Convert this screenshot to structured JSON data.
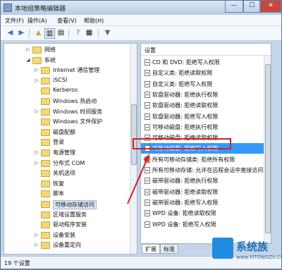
{
  "window": {
    "title": "本地组策略编辑器",
    "min": "—",
    "max": "☐",
    "close": "✕"
  },
  "menu": [
    "文件(F)",
    "操作(A)",
    "查看(V)",
    "帮助(H)"
  ],
  "toolbar": {
    "icons": [
      "back-icon",
      "forward-icon",
      "up-folder-icon",
      "show-tree-icon",
      "export-icon",
      "help-icon",
      "properties-icon",
      "filter-icon"
    ]
  },
  "tree": [
    {
      "label": "网络",
      "expander": "▷"
    },
    {
      "label": "系统",
      "expander": "◢"
    },
    {
      "label": "Internet 通信管理",
      "expander": "▷"
    },
    {
      "label": "iSCSI",
      "expander": "▷"
    },
    {
      "label": "Kerberos",
      "expander": ""
    },
    {
      "label": "Windows 热启动",
      "expander": ""
    },
    {
      "label": "Windows 时间服务",
      "expander": "▷"
    },
    {
      "label": "Windows 文件保护",
      "expander": ""
    },
    {
      "label": "磁盘配额",
      "expander": ""
    },
    {
      "label": "登录",
      "expander": ""
    },
    {
      "label": "电源管理",
      "expander": "▷"
    },
    {
      "label": "分布式 COM",
      "expander": "▷"
    },
    {
      "label": "关机选项",
      "expander": ""
    },
    {
      "label": "恢复",
      "expander": ""
    },
    {
      "label": "脚本",
      "expander": ""
    },
    {
      "label": "可移动存储访问",
      "expander": "",
      "selected": true
    },
    {
      "label": "区域设置服务",
      "expander": ""
    },
    {
      "label": "驱动程序安装",
      "expander": ""
    },
    {
      "label": "设备安装",
      "expander": "▷"
    },
    {
      "label": "设备重定向",
      "expander": "▷"
    }
  ],
  "list": {
    "header": "设置",
    "items": [
      {
        "label": "CD 和 DVD: 拒绝写入权限"
      },
      {
        "label": "自定义类: 拒绝读取权限"
      },
      {
        "label": "自定义类: 拒绝写入权限"
      },
      {
        "label": "软盘驱动器: 拒绝执行权限"
      },
      {
        "label": "软盘驱动器: 拒绝读取权限"
      },
      {
        "label": "软盘驱动器: 拒绝写入权限"
      },
      {
        "label": "可移动磁盘: 拒绝执行权限"
      },
      {
        "label": "可移动磁盘: 拒绝读取权限"
      },
      {
        "label": "可移动磁盘: 拒绝写入权限",
        "selected": true
      },
      {
        "label": "所有可移动存储类: 拒绝所有权限"
      },
      {
        "label": "所有可移动存储: 允许在远程会话中直接访问"
      },
      {
        "label": "磁带驱动器: 拒绝执行权限"
      },
      {
        "label": "磁带驱动器: 拒绝读取权限"
      },
      {
        "label": "磁带驱动器: 拒绝写入权限"
      },
      {
        "label": "WPD 设备: 拒绝读取权限"
      },
      {
        "label": "WPD 设备: 拒绝写入权限"
      }
    ]
  },
  "tabs": [
    "扩展",
    "标准"
  ],
  "status": "19 个设置",
  "watermark": {
    "brand": "系统族",
    "url": "www.XITONGZU.COM"
  },
  "colors": {
    "selection": "#3399ff",
    "highlight_box": "#d62020",
    "folder": "#f3d878"
  }
}
